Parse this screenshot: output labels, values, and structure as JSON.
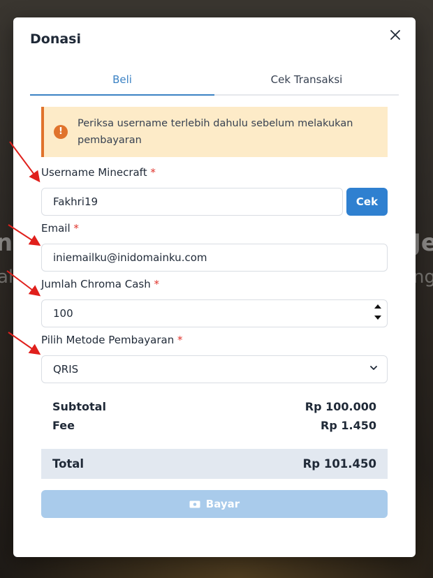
{
  "background": {
    "left_text_1": "n",
    "left_text_2": "al",
    "right_text_1": "Je",
    "right_text_2": "ng"
  },
  "modal": {
    "title": "Donasi",
    "close_icon": "close-icon"
  },
  "tabs": [
    {
      "label": "Beli",
      "active": true
    },
    {
      "label": "Cek Transaksi",
      "active": false
    }
  ],
  "alert": {
    "icon": "exclamation-icon",
    "text": "Periksa username terlebih dahulu sebelum melakukan pembayaran",
    "color": "#e0732c",
    "background": "#fdebc8"
  },
  "form": {
    "username": {
      "label": "Username Minecraft",
      "required": "*",
      "value": "Fakhri19",
      "button": "Cek"
    },
    "email": {
      "label": "Email",
      "required": "*",
      "value": "iniemailku@inidomainku.com"
    },
    "amount": {
      "label": "Jumlah Chroma Cash",
      "required": "*",
      "value": "100"
    },
    "payment": {
      "label": "Pilih Metode Pembayaran",
      "required": "*",
      "selected": "QRIS"
    }
  },
  "summary": {
    "subtotal_label": "Subtotal",
    "subtotal_value": "Rp 100.000",
    "fee_label": "Fee",
    "fee_value": "Rp 1.450",
    "total_label": "Total",
    "total_value": "Rp 101.450"
  },
  "pay_button": {
    "label": "Bayar",
    "icon": "cash-icon",
    "color": "#a9cbeb"
  },
  "colors": {
    "accent": "#2f80d0",
    "tab_active": "#3b82c4",
    "required": "#e0342c",
    "annotation_arrow": "#e0201c"
  }
}
